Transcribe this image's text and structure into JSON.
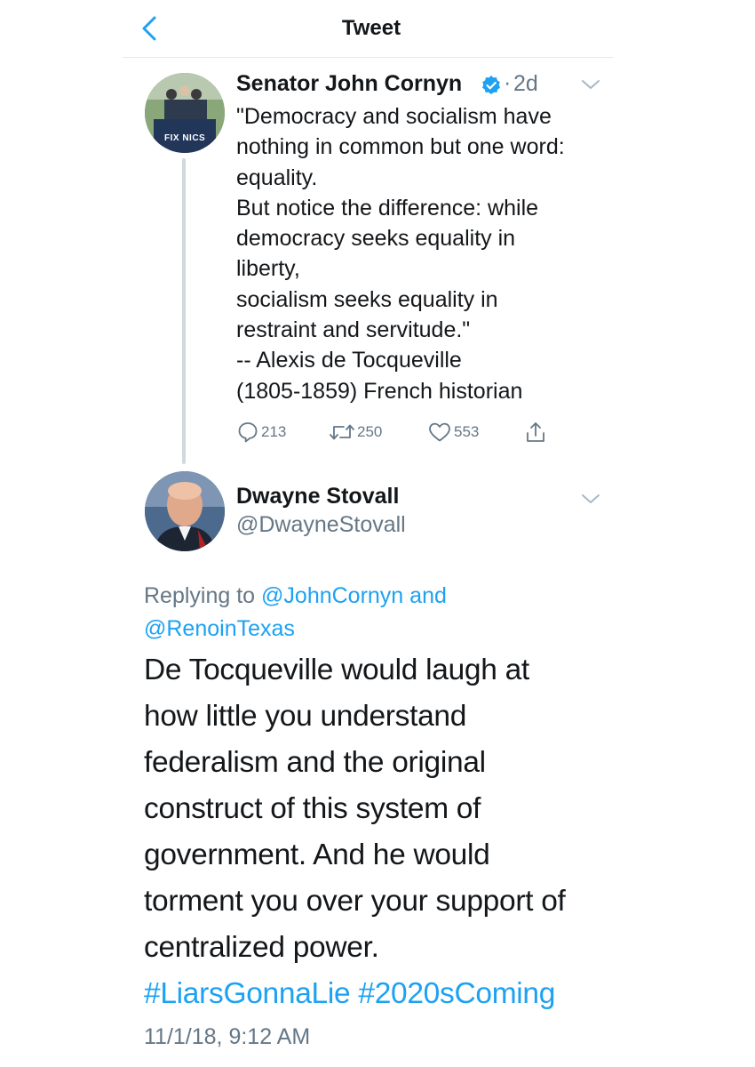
{
  "header": {
    "title": "Tweet"
  },
  "parent_tweet": {
    "author_name": "Senator John Cornyn",
    "separator": "·",
    "time_ago": "2d",
    "avatar_text": "FIX NICS",
    "text_lines": [
      "\"Democracy and socialism have",
      "nothing in common but one word:",
      "equality.",
      "But notice the difference: while",
      "democracy seeks equality in",
      "liberty,",
      "socialism seeks equality in",
      "restraint and servitude.\"",
      "-- Alexis de Tocqueville",
      "(1805-1859) French historian"
    ],
    "replies": "213",
    "retweets": "250",
    "likes": "553"
  },
  "reply_tweet": {
    "author_name": "Dwayne Stovall",
    "handle": "@DwayneStovall",
    "replying_prefix": "Replying to",
    "mention_1": "@JohnCornyn",
    "conjunction": "and",
    "mention_2": "@RenoinTexas",
    "text_lines": [
      "De Tocqueville would laugh at",
      "how little you understand",
      "federalism and the original",
      "construct of this system of",
      "government. And he would",
      "torment you over your support of",
      "centralized power."
    ],
    "hashtag_1": "#LiarsGonnaLie",
    "hashtag_2": "#2020sComing",
    "timestamp": "11/1/18, 9:12 AM"
  },
  "colors": {
    "accent": "#1da1f2",
    "secondary_text": "#657786",
    "primary_text": "#14171a",
    "divider": "#e1e8ed"
  },
  "icons": {
    "back": "chevron-left-icon",
    "verified": "verified-badge-icon",
    "menu": "chevron-down-icon",
    "reply": "reply-bubble-icon",
    "retweet": "retweet-icon",
    "like": "heart-icon",
    "share": "share-icon"
  }
}
